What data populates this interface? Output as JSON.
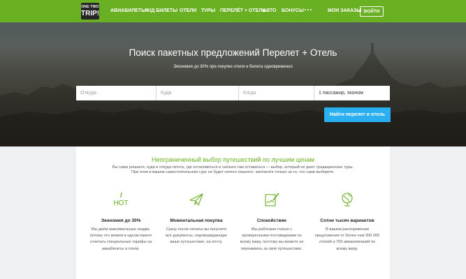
{
  "nav": {
    "logo_line1": "ONE TWO",
    "logo_line2": "TRIP!",
    "items": [
      "АВИАБИЛЕТЫ",
      "Ж/Д БИЛЕТЫ",
      "ОТЕЛИ",
      "ТУРЫ",
      "ПЕРЕЛЁТ + ОТЕЛЬ",
      "АВТО",
      "БОНУСЫ"
    ],
    "more_icon": "ellipsis-icon",
    "orders": "МОИ ЗАКАЗЫ",
    "login": "ВОЙТИ"
  },
  "hero": {
    "title": "Поиск пакетных предложений Перелет + Отель",
    "subtitle": "Экономия до 30% при покупке отеля и билета одновременно"
  },
  "search": {
    "from_placeholder": "Откуда",
    "to_placeholder": "Куда",
    "when_placeholder": "Когда",
    "passengers": "1 пассажир, эконом",
    "submit": "Найти перелет и отель"
  },
  "features": {
    "title": "Неограниченный выбор путешествий по лучшим ценам",
    "description_line1": "Вы сами решаете, куда и откуда лететь, где остановиться и сколько там оставаться — выбор, который не дают традиционные туры.",
    "description_line2": "При этом в вашем самостоятельном туре не будет ничего лишнего: заплатите только за то, что сами выберете.",
    "items": [
      {
        "icon": "hot-icon",
        "title": "Экономия до 30%",
        "text": "Мы даём максимальные скидки, потому что можем в одном пакете сочетать специальные тарифы на авиабилеты и отели."
      },
      {
        "icon": "paper-plane-icon",
        "title": "Моментальная покупка",
        "text": "Сразу после оплаты вы получите все документы, подтверждающие ваше путешествие, на почту."
      },
      {
        "icon": "signature-icon",
        "title": "Спокойствие",
        "text": "Мы работаем только с проверенными поставщиками по всему миру, поэтому вы можете не переживать за своё путешествие."
      },
      {
        "icon": "globe-icon",
        "title": "Сотни тысяч вариантов",
        "text": "В вашем распоряжении предложения от более чем 300 000 отелей и 700 авиакомпаний по всему миру."
      }
    ]
  },
  "colors": {
    "brand_green": "#6ab023",
    "button_blue": "#2ab0f1",
    "logo_dark": "#262626"
  }
}
